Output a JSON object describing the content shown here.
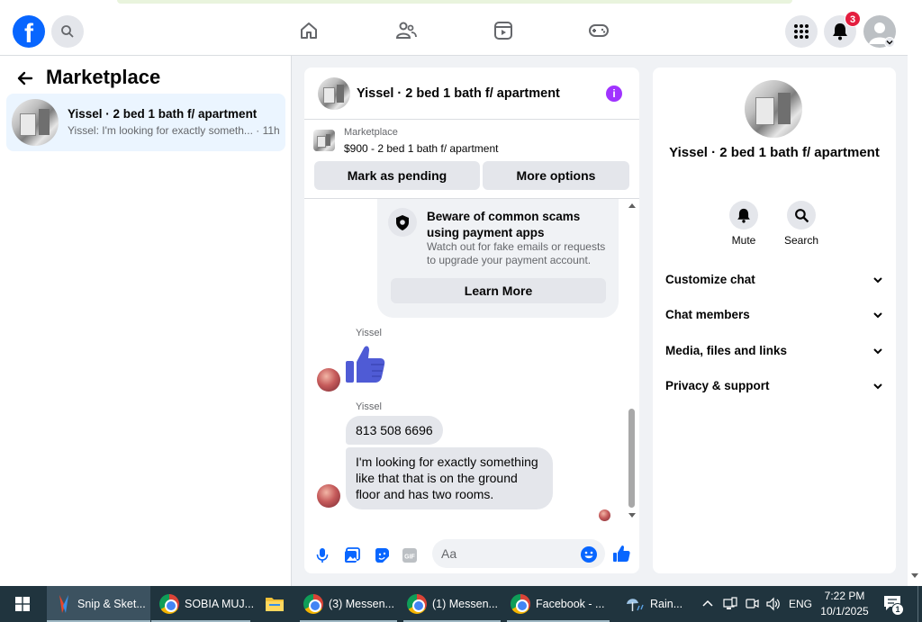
{
  "header": {
    "logo": "f",
    "notification_count": "3",
    "icons": [
      "search-icon",
      "home-icon",
      "friends-icon",
      "video-icon",
      "gaming-icon",
      "menu-grid-icon",
      "bell-icon",
      "profile-icon"
    ]
  },
  "left_panel": {
    "title": "Marketplace",
    "conversation": {
      "name": "Yissel · 2 bed 1 bath f/ apartment",
      "preview": "Yissel: I'm looking for exactly someth...",
      "time": "· 11h"
    }
  },
  "chat": {
    "title": "Yissel · 2 bed 1 bath f/ apartment",
    "marketplace_label": "Marketplace",
    "listing": "$900 - 2 bed 1 bath f/ apartment",
    "buttons": {
      "pending": "Mark as pending",
      "more": "More options"
    },
    "scam_notice": {
      "title": "Beware of common scams using payment apps",
      "body": "Watch out for fake emails or requests to upgrade your payment account.",
      "button": "Learn More"
    },
    "messages": [
      {
        "sender": "Yissel",
        "type": "like"
      },
      {
        "sender": "Yissel",
        "text": "813 508 6696"
      },
      {
        "sender": "",
        "text": "I'm looking for exactly something like that that is on the ground floor and has two rooms."
      }
    ],
    "composer_placeholder": "Aa"
  },
  "right_panel": {
    "name": "Yissel · 2 bed 1 bath f/ apartment",
    "actions": {
      "mute": "Mute",
      "search": "Search"
    },
    "sections": [
      "Customize chat",
      "Chat members",
      "Media, files and links",
      "Privacy & support"
    ]
  },
  "taskbar": {
    "apps": [
      {
        "label": "Snip & Sket..."
      },
      {
        "label": "SOBIA MUJ..."
      },
      {
        "label": "(3) Messen..."
      },
      {
        "label": "(1) Messen..."
      },
      {
        "label": "Facebook - ..."
      }
    ],
    "weather": "Rain...",
    "language": "ENG",
    "time": "7:22 PM",
    "date": "10/1/2025",
    "notification_count": "1"
  },
  "colors": {
    "brand": "#0866ff",
    "accent_purple": "#a033ff",
    "like_blue": "#4f5bd5",
    "badge_red": "#e41e3f",
    "taskbar": "#20343e"
  }
}
